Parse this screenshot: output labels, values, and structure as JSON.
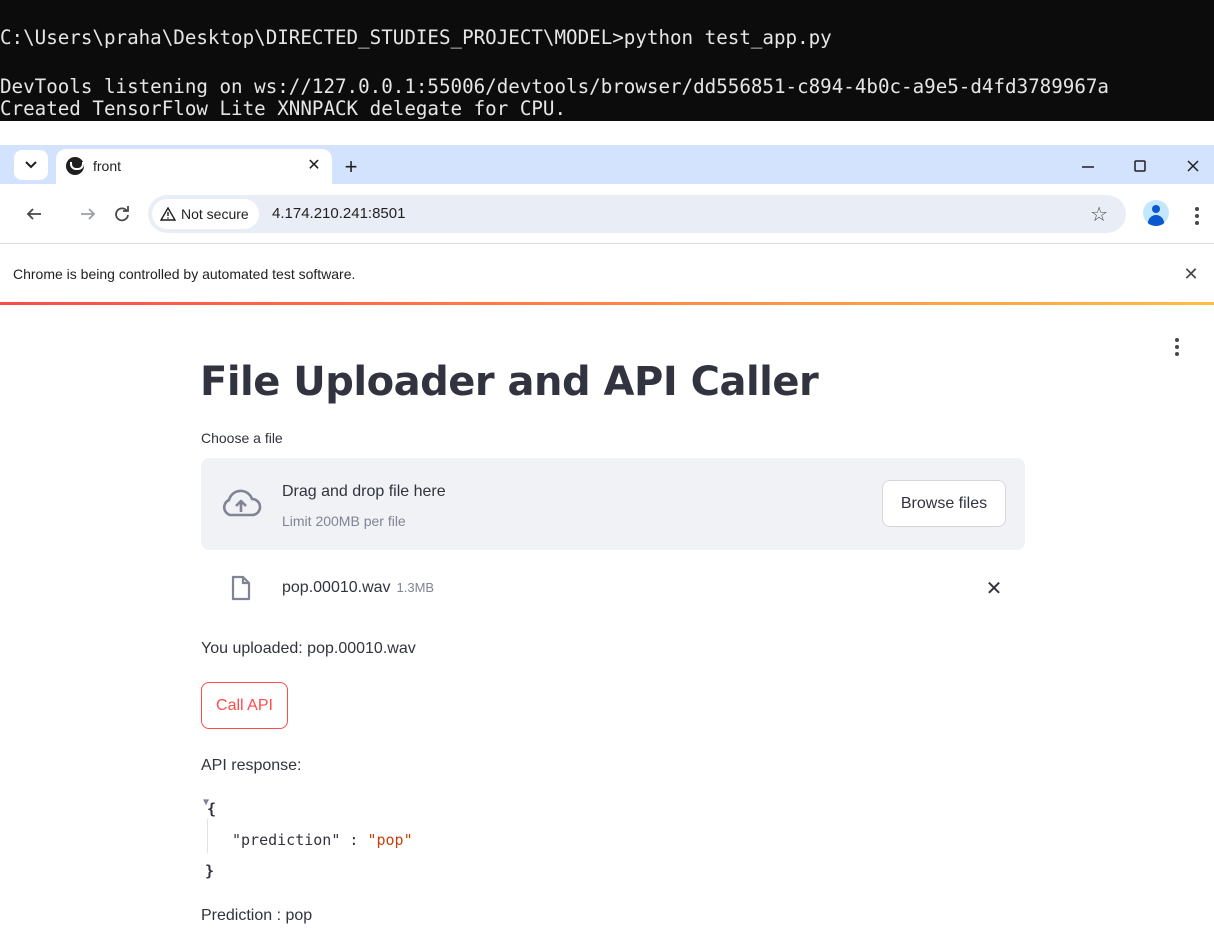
{
  "terminal": {
    "lines": [
      "C:\\Users\\praha\\Desktop\\DIRECTED_STUDIES_PROJECT\\MODEL>python test_app.py",
      "DevTools listening on ws://127.0.0.1:55006/devtools/browser/dd556851-c894-4b0c-a9e5-d4fd3789967a",
      "Created TensorFlow Lite XNNPACK delegate for CPU."
    ]
  },
  "browser": {
    "tab_title": "front",
    "new_tab": "+",
    "tab_close": "✕",
    "security_label": "Not secure",
    "url": "4.174.210.241:8501",
    "infobar_text": "Chrome is being controlled by automated test software.",
    "infobar_close": "✕",
    "colors": {
      "tabstrip": "#d3e3fd",
      "omnibox": "#e9eef6"
    },
    "icons": [
      "tab-search-icon",
      "favicon-icon",
      "minimize-icon",
      "maximize-icon",
      "close-window-icon",
      "back-icon",
      "forward-icon",
      "reload-icon",
      "warning-icon",
      "bookmark-star-icon",
      "profile-avatar-icon",
      "menu-dots-icon"
    ]
  },
  "app": {
    "title": "File Uploader and API Caller",
    "uploader_label": "Choose a file",
    "drop_title": "Drag and drop file here",
    "drop_limit": "Limit 200MB per file",
    "browse_label": "Browse files",
    "file": {
      "name": "pop.00010.wav",
      "size": "1.3MB",
      "remove": "✕"
    },
    "uploaded_text": "You uploaded: pop.00010.wav",
    "call_button": "Call API",
    "api_response_label": "API response:",
    "json": {
      "open": "{",
      "key": "\"prediction\"",
      "sep": " : ",
      "value": "\"pop\"",
      "close": "}"
    },
    "prediction_text": "Prediction : pop",
    "colors": {
      "primary": "#ff4b4b",
      "text": "#31333f",
      "dropzone": "#f0f2f6",
      "json_value": "#c7410d"
    },
    "icons": [
      "cloud-upload-icon",
      "file-icon",
      "app-menu-icon",
      "json-collapse-icon"
    ]
  }
}
